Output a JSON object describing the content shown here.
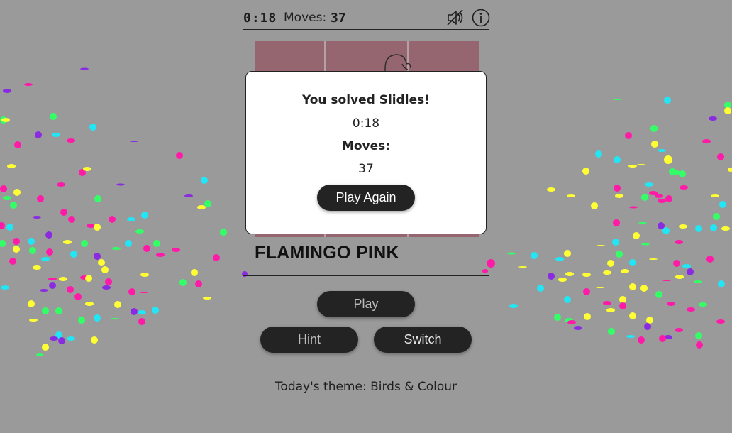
{
  "header": {
    "timer": "0:18",
    "moves_label": "Moves:",
    "moves_value": "37",
    "sound_icon": "speaker-muted-icon",
    "info_icon": "info-circle-icon"
  },
  "board": {
    "color_name": "FLAMINGO PINK",
    "tile_color": "#956570"
  },
  "modal": {
    "title": "You solved Slidles!",
    "time": "0:18",
    "moves_label": "Moves:",
    "moves_value": "37",
    "play_again_label": "Play Again"
  },
  "controls": {
    "play_label": "Play",
    "hint_label": "Hint",
    "switch_label": "Switch"
  },
  "footer": {
    "theme_text": "Today's theme: Birds & Colour"
  },
  "confetti_colors": [
    "#ff1aa8",
    "#ffff33",
    "#33ff66",
    "#22e5f5",
    "#8a2be2"
  ]
}
